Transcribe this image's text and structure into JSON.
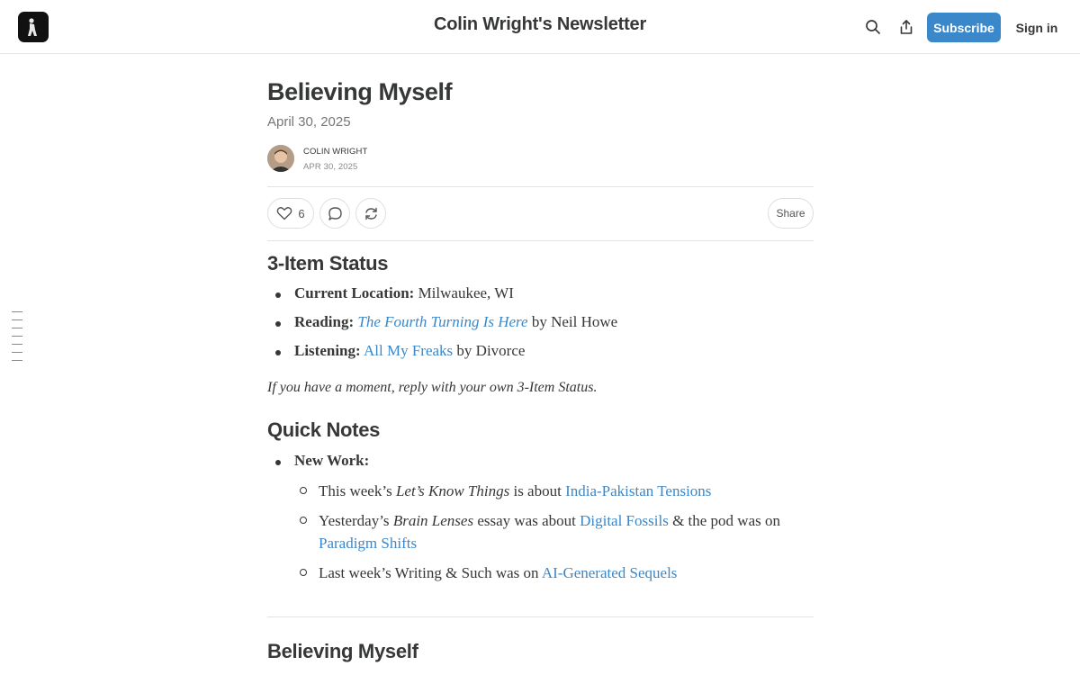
{
  "header": {
    "site_title": "Colin Wright's Newsletter",
    "subscribe_label": "Subscribe",
    "signin_label": "Sign in",
    "icons": [
      "search-icon",
      "share-icon"
    ]
  },
  "post": {
    "title": "Believing Myself",
    "subtitle_date": "April 30, 2025",
    "author": "COLIN WRIGHT",
    "author_date": "APR 30, 2025",
    "likes": "6",
    "share_label": "Share"
  },
  "status": {
    "heading": "3-Item Status",
    "items": [
      {
        "label": "Current Location:",
        "text": " Milwaukee, WI"
      },
      {
        "label": "Reading:",
        "link": "The Fourth Turning Is Here",
        "text": " by Neil Howe"
      },
      {
        "label": "Listening:",
        "link": "All My Freaks",
        "text": " by Divorce"
      }
    ],
    "note": "If you have a moment, reply with your own 3-Item Status."
  },
  "quick_notes": {
    "heading": "Quick Notes",
    "new_work_label": "New Work:",
    "sub_items": [
      {
        "pre": "This week’s ",
        "em": "Let’s Know Things",
        "mid": " is about ",
        "link": "India-Pakistan Tensions"
      },
      {
        "pre": "Yesterday’s ",
        "em": "Brain Lenses",
        "mid": " essay was about ",
        "link": "Digital Fossils",
        "mid2": " & the pod was on ",
        "link2": "Paradigm Shifts"
      },
      {
        "pre": "Last week’s Writing & Such was on ",
        "link": "AI-Generated Sequels"
      }
    ]
  },
  "next_section": {
    "heading": "Believing Myself"
  },
  "colors": {
    "accent": "#3a87c9",
    "text": "#363737",
    "muted": "#777777",
    "border": "#e3e3e3"
  }
}
